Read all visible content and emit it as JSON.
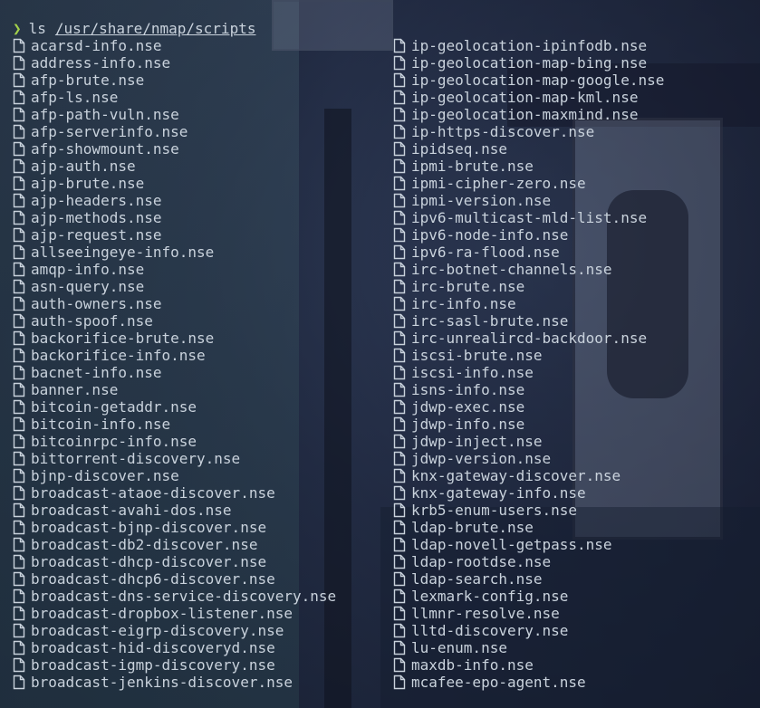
{
  "prompt": {
    "symbol": "❯",
    "command": "ls",
    "path": "/usr/share/nmap/scripts"
  },
  "colors": {
    "prompt_symbol": "#a3d14b",
    "text": "#c9d2dc"
  },
  "icons": {
    "file": "file-icon"
  },
  "files_left": [
    "acarsd-info.nse",
    "address-info.nse",
    "afp-brute.nse",
    "afp-ls.nse",
    "afp-path-vuln.nse",
    "afp-serverinfo.nse",
    "afp-showmount.nse",
    "ajp-auth.nse",
    "ajp-brute.nse",
    "ajp-headers.nse",
    "ajp-methods.nse",
    "ajp-request.nse",
    "allseeingeye-info.nse",
    "amqp-info.nse",
    "asn-query.nse",
    "auth-owners.nse",
    "auth-spoof.nse",
    "backorifice-brute.nse",
    "backorifice-info.nse",
    "bacnet-info.nse",
    "banner.nse",
    "bitcoin-getaddr.nse",
    "bitcoin-info.nse",
    "bitcoinrpc-info.nse",
    "bittorrent-discovery.nse",
    "bjnp-discover.nse",
    "broadcast-ataoe-discover.nse",
    "broadcast-avahi-dos.nse",
    "broadcast-bjnp-discover.nse",
    "broadcast-db2-discover.nse",
    "broadcast-dhcp-discover.nse",
    "broadcast-dhcp6-discover.nse",
    "broadcast-dns-service-discovery.nse",
    "broadcast-dropbox-listener.nse",
    "broadcast-eigrp-discovery.nse",
    "broadcast-hid-discoveryd.nse",
    "broadcast-igmp-discovery.nse",
    "broadcast-jenkins-discover.nse"
  ],
  "files_right": [
    "ip-geolocation-ipinfodb.nse",
    "ip-geolocation-map-bing.nse",
    "ip-geolocation-map-google.nse",
    "ip-geolocation-map-kml.nse",
    "ip-geolocation-maxmind.nse",
    "ip-https-discover.nse",
    "ipidseq.nse",
    "ipmi-brute.nse",
    "ipmi-cipher-zero.nse",
    "ipmi-version.nse",
    "ipv6-multicast-mld-list.nse",
    "ipv6-node-info.nse",
    "ipv6-ra-flood.nse",
    "irc-botnet-channels.nse",
    "irc-brute.nse",
    "irc-info.nse",
    "irc-sasl-brute.nse",
    "irc-unrealircd-backdoor.nse",
    "iscsi-brute.nse",
    "iscsi-info.nse",
    "isns-info.nse",
    "jdwp-exec.nse",
    "jdwp-info.nse",
    "jdwp-inject.nse",
    "jdwp-version.nse",
    "knx-gateway-discover.nse",
    "knx-gateway-info.nse",
    "krb5-enum-users.nse",
    "ldap-brute.nse",
    "ldap-novell-getpass.nse",
    "ldap-rootdse.nse",
    "ldap-search.nse",
    "lexmark-config.nse",
    "llmnr-resolve.nse",
    "lltd-discovery.nse",
    "lu-enum.nse",
    "maxdb-info.nse",
    "mcafee-epo-agent.nse"
  ]
}
